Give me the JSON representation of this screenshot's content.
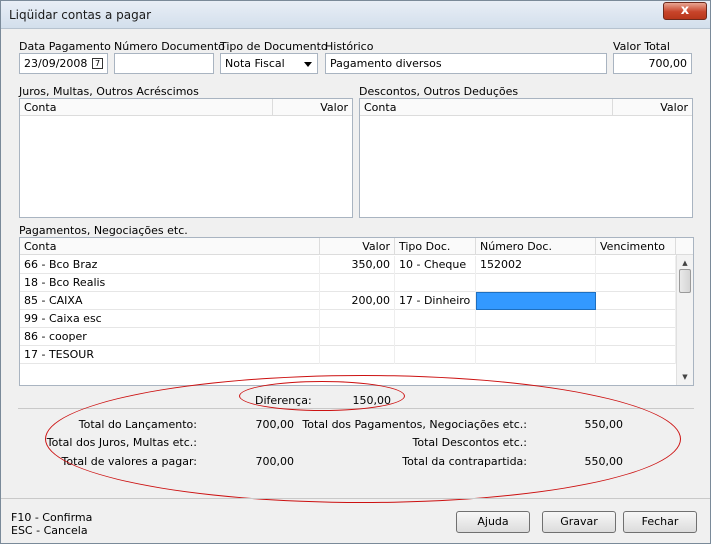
{
  "window": {
    "title": "Liqüidar contas a pagar",
    "close_label": "x"
  },
  "header": {
    "data_pagamento": {
      "label": "Data Pagamento",
      "value": "23/09/2008"
    },
    "numero_documento": {
      "label": "Número Documento",
      "value": ""
    },
    "tipo_documento": {
      "label": "Tipo de Documento",
      "value": "Nota Fiscal"
    },
    "historico": {
      "label": "Histórico",
      "value": "Pagamento diversos"
    },
    "valor_total": {
      "label": "Valor Total",
      "value": "700,00"
    }
  },
  "juros": {
    "title": "Juros, Multas, Outros Acréscimos",
    "columns": [
      "Conta",
      "Valor"
    ]
  },
  "descontos": {
    "title": "Descontos, Outros Deduções",
    "columns": [
      "Conta",
      "Valor"
    ]
  },
  "pagamentos": {
    "title": "Pagamentos, Negociações etc.",
    "columns": [
      "Conta",
      "Valor",
      "Tipo Doc.",
      "Número Doc.",
      "Vencimento"
    ],
    "rows": [
      [
        "66 - Bco Braz",
        "350,00",
        "10 - Cheque",
        "152002",
        ""
      ],
      [
        "18 - Bco Realis",
        "",
        "",
        "",
        ""
      ],
      [
        "85 - CAIXA",
        "200,00",
        "17 - Dinheiro",
        "",
        ""
      ],
      [
        "99 - Caixa esc",
        "",
        "",
        "",
        ""
      ],
      [
        "86 - cooper",
        "",
        "",
        "",
        ""
      ],
      [
        "17 - TESOUR",
        "",
        "",
        "",
        ""
      ]
    ]
  },
  "diferenca": {
    "label": "Diferença:",
    "value": "150,00"
  },
  "totais": {
    "lancamento": {
      "label": "Total do Lançamento:",
      "value": "700,00"
    },
    "juros": {
      "label": "Total dos Juros, Multas etc.:",
      "value": ""
    },
    "a_pagar": {
      "label": "Total de valores a pagar:",
      "value": "700,00"
    },
    "pagamentos": {
      "label": "Total dos Pagamentos, Negociações etc.:",
      "value": "550,00"
    },
    "descontos": {
      "label": "Total Descontos etc.:",
      "value": ""
    },
    "contrapartida": {
      "label": "Total da contrapartida:",
      "value": "550,00"
    }
  },
  "shortcuts": {
    "f10": "F10 - Confirma",
    "esc": "ESC - Cancela"
  },
  "buttons": {
    "ajuda": "Ajuda",
    "gravar": "Gravar",
    "fechar": "Fechar"
  },
  "colors": {
    "annotation": "#cc1111",
    "selection": "#3399ff"
  }
}
